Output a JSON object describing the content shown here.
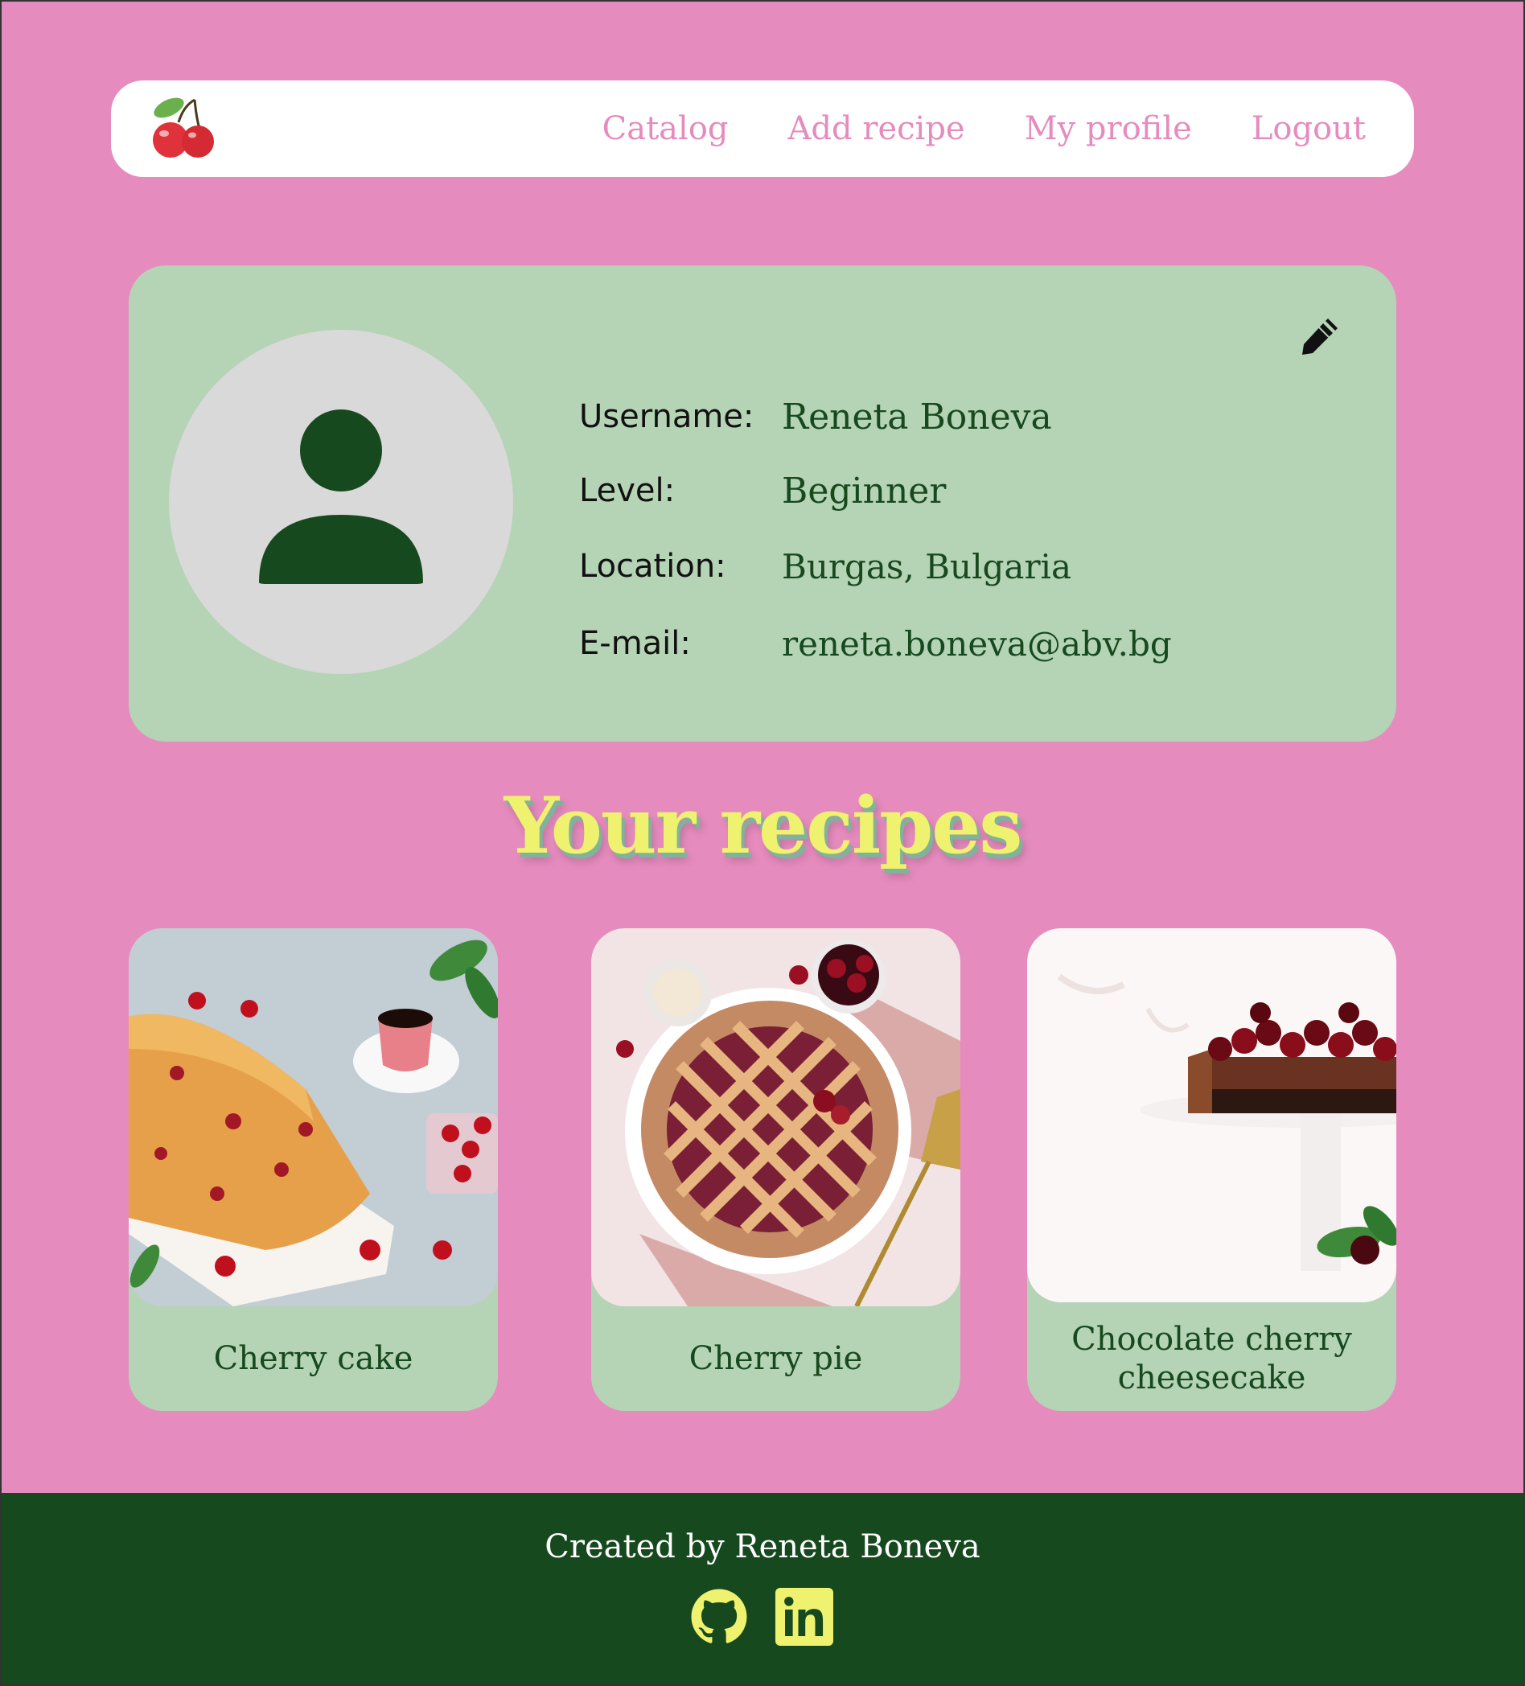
{
  "nav": {
    "logo_icon": "cherry-logo-icon",
    "links": [
      "Catalog",
      "Add recipe",
      "My profile",
      "Logout"
    ]
  },
  "profile": {
    "avatar_icon": "user-avatar-icon",
    "edit_icon": "pencil-icon",
    "fields": [
      {
        "label": "Username:",
        "value": "Reneta Boneva"
      },
      {
        "label": "Level:",
        "value": "Beginner"
      },
      {
        "label": "Location:",
        "value": "Burgas, Bulgaria"
      },
      {
        "label": "E-mail:",
        "value": "reneta.boneva@abv.bg"
      }
    ]
  },
  "recipes": {
    "title": "Your recipes",
    "items": [
      {
        "name": "Cherry cake"
      },
      {
        "name": "Cherry pie"
      },
      {
        "name": "Chocolate cherry cheesecake"
      }
    ]
  },
  "footer": {
    "text": "Created by Reneta Boneva",
    "icons": [
      "github-icon",
      "linkedin-icon"
    ]
  },
  "colors": {
    "background": "#e68bbe",
    "card": "#b5d3b5",
    "dark_green": "#17491e",
    "accent_yellow": "#eef26e"
  }
}
